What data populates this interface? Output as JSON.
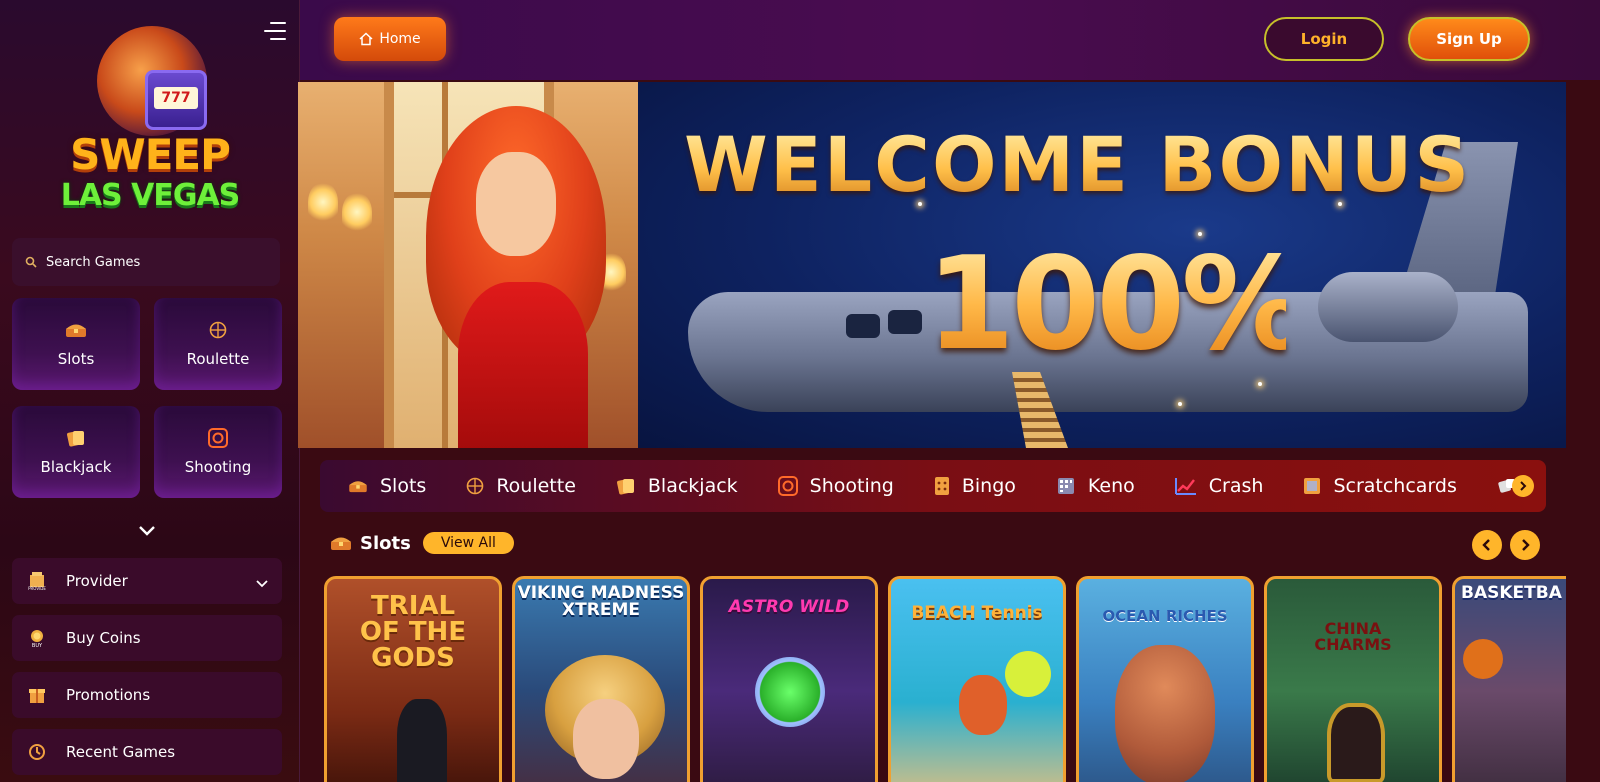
{
  "sidebar": {
    "logo": {
      "line1": "SWEEP",
      "line2": "LAS VEGAS",
      "slot_digits": "777"
    },
    "search_label": "Search Games",
    "categories": [
      {
        "label": "Slots",
        "icon": "treasure-chest-icon"
      },
      {
        "label": "Roulette",
        "icon": "roulette-wheel-icon"
      },
      {
        "label": "Blackjack",
        "icon": "cards-icon"
      },
      {
        "label": "Shooting",
        "icon": "target-icon"
      }
    ],
    "menu": [
      {
        "label": "Provider",
        "icon": "provider-icon"
      },
      {
        "label": "Buy Coins",
        "icon": "buy-coins-icon"
      },
      {
        "label": "Promotions",
        "icon": "promotions-icon"
      },
      {
        "label": "Recent Games",
        "icon": "recent-games-icon"
      }
    ]
  },
  "topbar": {
    "home_label": "Home",
    "login_label": "Login",
    "signup_label": "Sign Up"
  },
  "hero": {
    "title": "WELCOME BONUS",
    "percent": "100%"
  },
  "category_bar": [
    {
      "label": "Slots",
      "icon": "treasure-chest-icon"
    },
    {
      "label": "Roulette",
      "icon": "roulette-wheel-icon"
    },
    {
      "label": "Blackjack",
      "icon": "cards-icon"
    },
    {
      "label": "Shooting",
      "icon": "target-icon"
    },
    {
      "label": "Bingo",
      "icon": "bingo-card-icon"
    },
    {
      "label": "Keno",
      "icon": "keno-icon"
    },
    {
      "label": "Crash",
      "icon": "crash-chart-icon"
    },
    {
      "label": "Scratchcards",
      "icon": "scratchcard-icon"
    }
  ],
  "slots_section": {
    "title": "Slots",
    "view_all": "View All",
    "games": [
      {
        "title": "TRIAL\nOF THE\nGODS"
      },
      {
        "title": "VIKING MADNESS\nXTREME"
      },
      {
        "title": "ASTRO WILD"
      },
      {
        "title": "BEACH Tennis"
      },
      {
        "title": "OCEAN RICHES"
      },
      {
        "title": "CHINA\nCHARMS"
      },
      {
        "title": "BASKETBA"
      }
    ]
  },
  "colors": {
    "accent_orange": "#ff7a1a",
    "accent_gold": "#ffb52a",
    "card_border": "#f0a030",
    "login_border": "#c6c02a"
  }
}
